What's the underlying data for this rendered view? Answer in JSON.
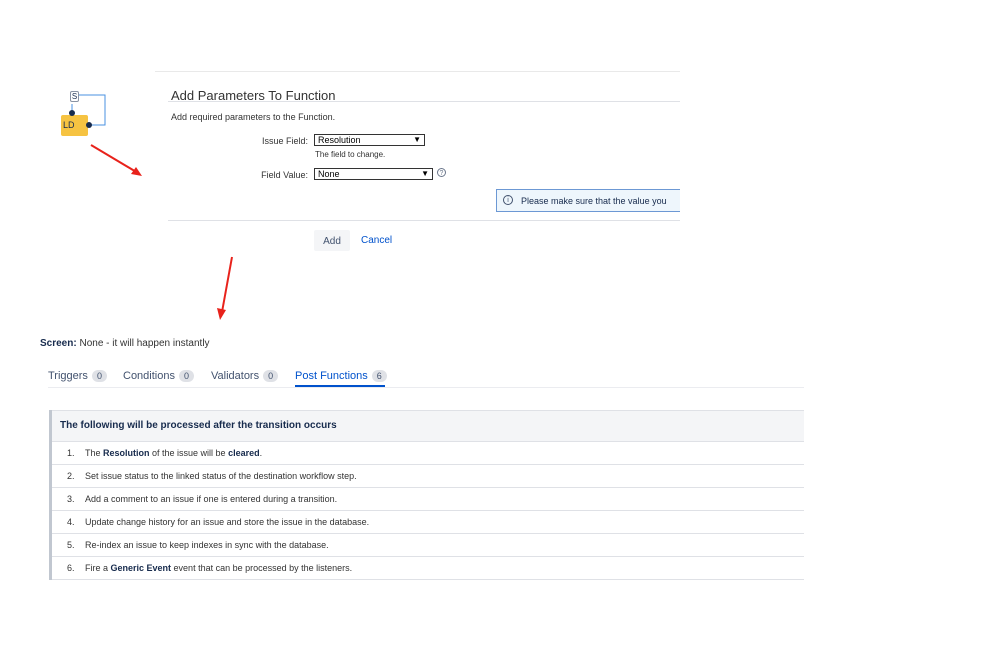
{
  "workflow": {
    "start_label": "S",
    "step_label": "LD"
  },
  "dialog": {
    "title": "Add Parameters To Function",
    "description": "Add required parameters to the Function.",
    "issue_field": {
      "label": "Issue Field:",
      "selected": "Resolution",
      "help": "The field to change."
    },
    "field_value": {
      "label": "Field Value:",
      "selected": "None",
      "help_icon": "question-icon"
    },
    "info_message": "Please make sure that the value you",
    "info_icon": "info-icon",
    "add_label": "Add",
    "cancel_label": "Cancel"
  },
  "screen": {
    "label": "Screen:",
    "value": "None - it will happen instantly"
  },
  "tabs": [
    {
      "label": "Triggers",
      "count": "0"
    },
    {
      "label": "Conditions",
      "count": "0"
    },
    {
      "label": "Validators",
      "count": "0"
    },
    {
      "label": "Post Functions",
      "count": "6"
    }
  ],
  "post_functions": {
    "header": "The following will be processed after the transition occurs",
    "items": [
      {
        "num": "1.",
        "pre": "The ",
        "b1": "Resolution",
        "mid": " of the issue will be ",
        "b2": "cleared",
        "post": "."
      },
      {
        "num": "2.",
        "text": "Set issue status to the linked status of the destination workflow step."
      },
      {
        "num": "3.",
        "text": "Add a comment to an issue if one is entered during a transition."
      },
      {
        "num": "4.",
        "text": "Update change history for an issue and store the issue in the database."
      },
      {
        "num": "5.",
        "text": "Re-index an issue to keep indexes in sync with the database."
      },
      {
        "num": "6.",
        "pre": "Fire a ",
        "b1": "Generic Event",
        "post": " event that can be processed by the listeners."
      }
    ]
  },
  "colors": {
    "accent": "#0052cc",
    "annotation_arrow": "#e8221b",
    "step_fill": "#f6c342"
  }
}
